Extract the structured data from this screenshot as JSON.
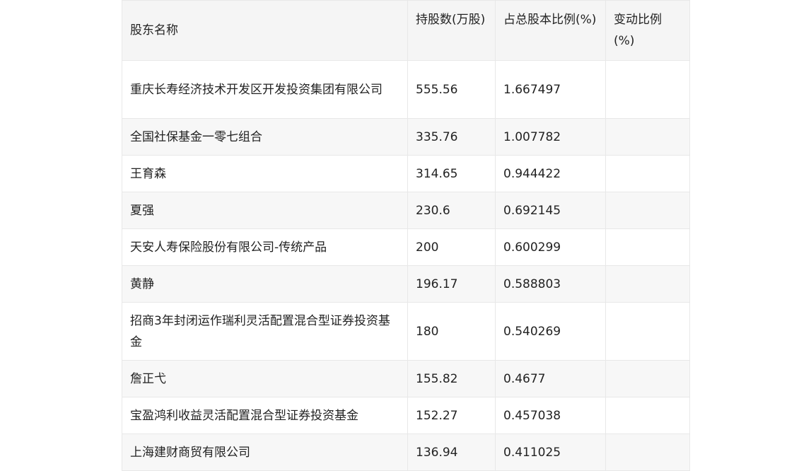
{
  "table": {
    "headers": [
      "股东名称",
      "持股数(万股)",
      "占总股本比例(%)",
      "变动比例(%)"
    ],
    "rows": [
      [
        "重庆长寿经济技术开发区开发投资集团有限公司",
        "555.56",
        "1.667497",
        ""
      ],
      [
        "全国社保基金一零七组合",
        "335.76",
        "1.007782",
        ""
      ],
      [
        "王育森",
        "314.65",
        "0.944422",
        ""
      ],
      [
        "夏强",
        "230.6",
        "0.692145",
        ""
      ],
      [
        "天安人寿保险股份有限公司-传统产品",
        "200",
        "0.600299",
        ""
      ],
      [
        "黄静",
        "196.17",
        "0.588803",
        ""
      ],
      [
        "招商3年封闭运作瑞利灵活配置混合型证券投资基金",
        "180",
        "0.540269",
        ""
      ],
      [
        "詹正弋",
        "155.82",
        "0.4677",
        ""
      ],
      [
        "宝盈鸿利收益灵活配置混合型证券投资基金",
        "152.27",
        "0.457038",
        ""
      ],
      [
        "上海建财商贸有限公司",
        "136.94",
        "0.411025",
        ""
      ]
    ]
  }
}
